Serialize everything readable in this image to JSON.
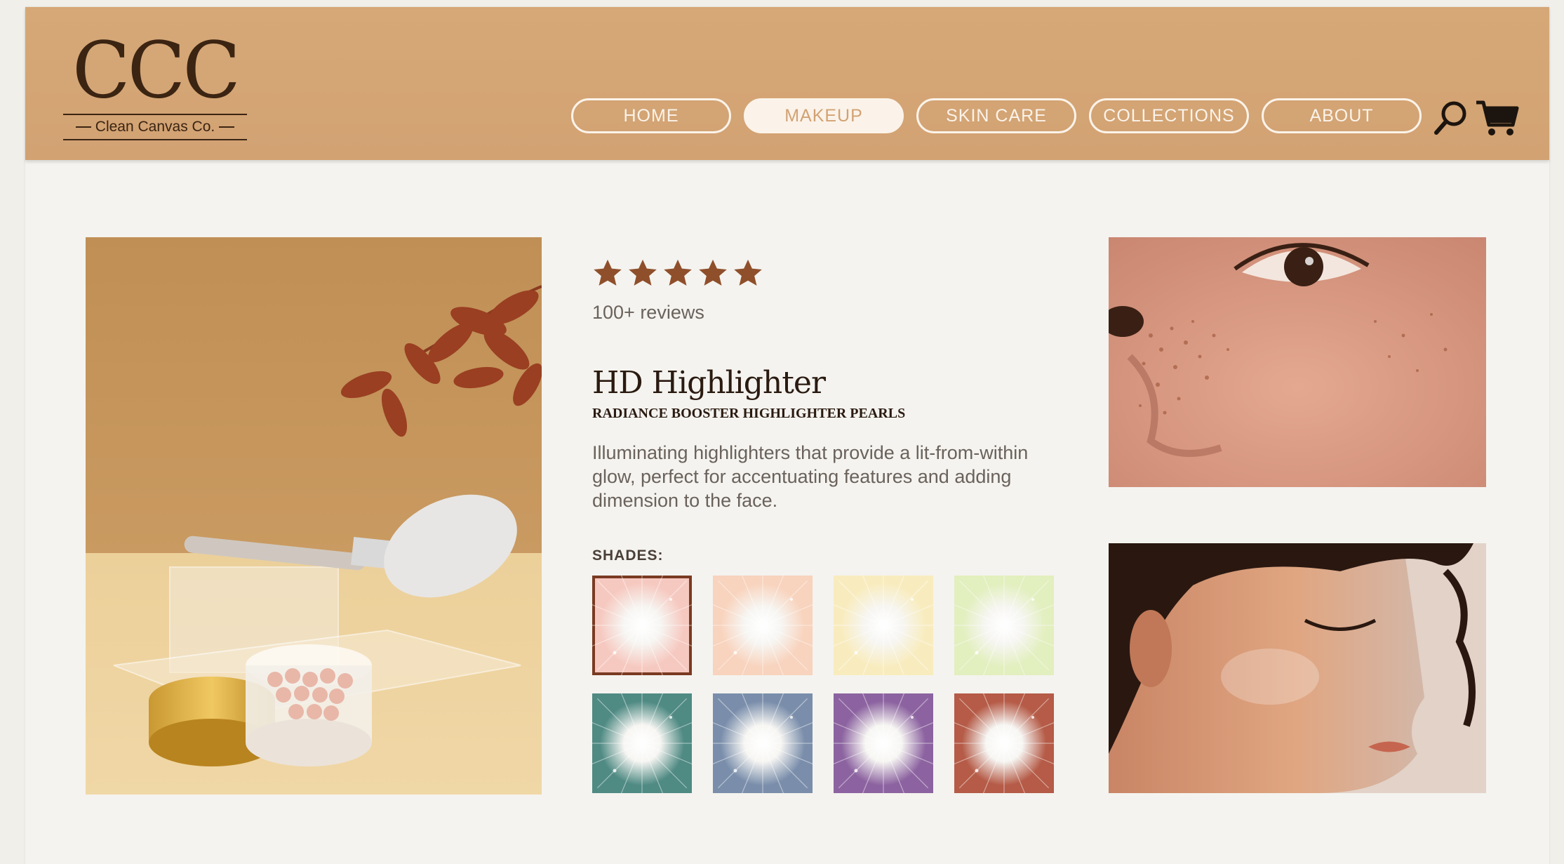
{
  "brand": {
    "mark": "CCC",
    "name": "Clean Canvas Co."
  },
  "nav": {
    "items": [
      {
        "label": "HOME",
        "active": false
      },
      {
        "label": "MAKEUP",
        "active": true
      },
      {
        "label": "SKIN CARE",
        "active": false
      },
      {
        "label": "COLLECTIONS",
        "active": false
      },
      {
        "label": "ABOUT",
        "active": false
      }
    ],
    "icons": [
      "search-icon",
      "cart-icon"
    ]
  },
  "product": {
    "rating": 5,
    "reviews": "100+ reviews",
    "title": "HD Highlighter",
    "subtitle": "RADIANCE BOOSTER HIGHLIGHTER PEARLS",
    "description": "Illuminating highlighters that provide a lit-from-within glow, perfect for accentuating features and adding dimension to the face.",
    "shades_label": "SHADES:",
    "shades": [
      {
        "color": "#f6c9c0",
        "selected": true
      },
      {
        "color": "#f8d3bd",
        "selected": false
      },
      {
        "color": "#f8ecbf",
        "selected": false
      },
      {
        "color": "#e2efbe",
        "selected": false
      },
      {
        "color": "#4f8a83",
        "selected": false
      },
      {
        "color": "#7a8eab",
        "selected": false
      },
      {
        "color": "#8c63a0",
        "selected": false
      },
      {
        "color": "#b55b47",
        "selected": false
      }
    ]
  },
  "colors": {
    "header": "#d3a374",
    "nav_text": "#fbf3ea",
    "accent_dark": "#3b2412",
    "star": "#8f4f2b"
  }
}
